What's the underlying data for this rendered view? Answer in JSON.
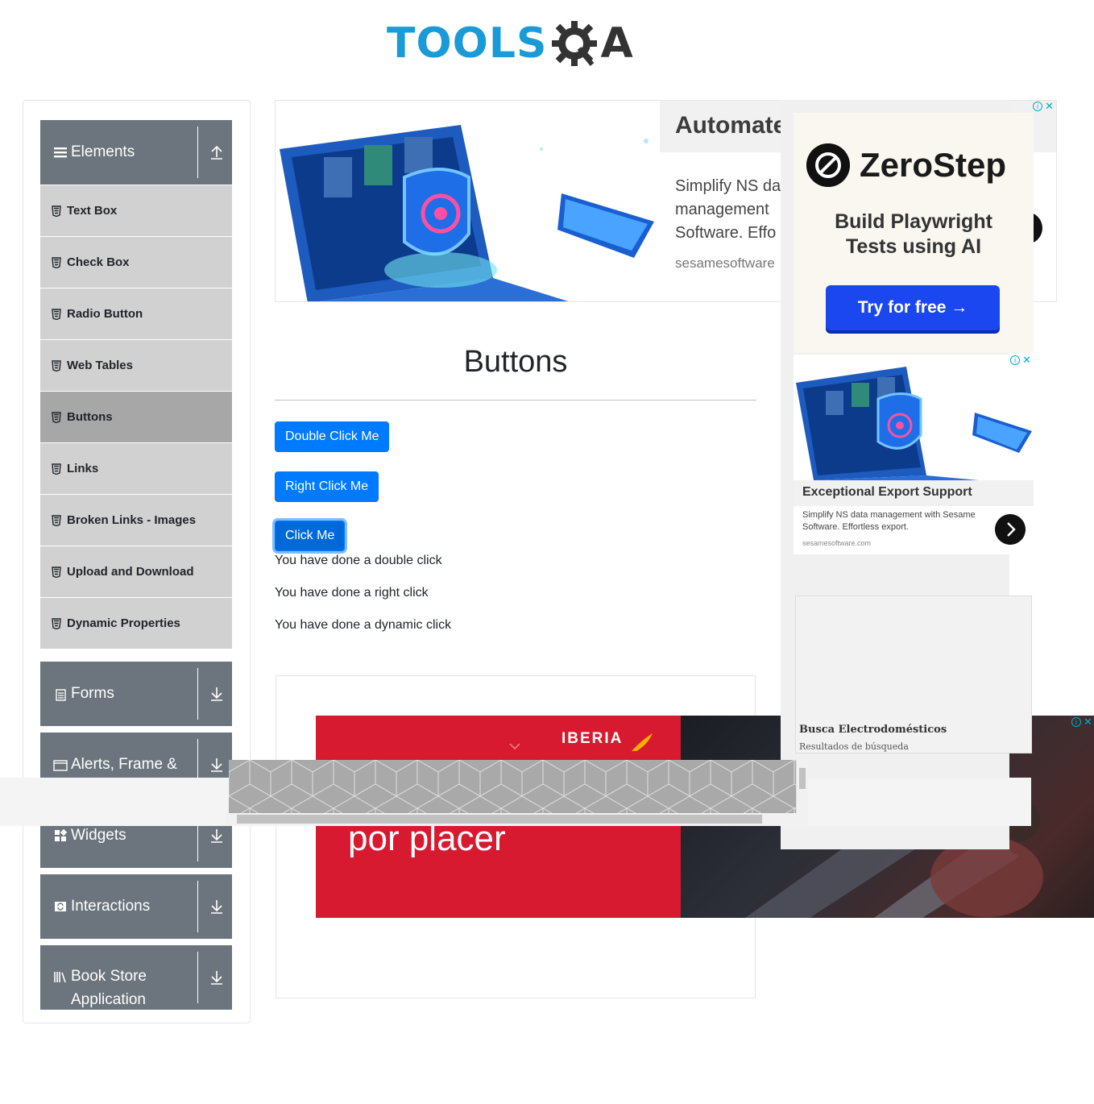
{
  "header": {
    "logo_text": "TOOLS",
    "logo_suffix": "A"
  },
  "sidebar": {
    "groups": [
      {
        "label": "Elements",
        "expanded": true
      },
      {
        "label": "Forms"
      },
      {
        "label": "Alerts, Frame &"
      },
      {
        "label": "Widgets"
      },
      {
        "label": "Interactions"
      },
      {
        "label": "Book Store Application"
      }
    ],
    "items": [
      {
        "label": "Text Box"
      },
      {
        "label": "Check Box"
      },
      {
        "label": "Radio Button"
      },
      {
        "label": "Web Tables"
      },
      {
        "label": "Buttons",
        "active": true
      },
      {
        "label": "Links"
      },
      {
        "label": "Broken Links - Images"
      },
      {
        "label": "Upload and Download"
      },
      {
        "label": "Dynamic Properties"
      }
    ]
  },
  "main": {
    "title": "Buttons",
    "buttons": {
      "double_click": "Double Click Me",
      "right_click": "Right Click Me",
      "click": "Click Me"
    },
    "messages": {
      "double": "You have done a double click",
      "right": "You have done a right click",
      "dynamic": "You have done a dynamic click"
    }
  },
  "ads": {
    "top": {
      "title": "Automate",
      "body_line1": "Simplify NS da",
      "body_line2": "management",
      "body_line3": "Software. Effo",
      "url": "sesamesoftware"
    },
    "zerostep": {
      "brand": "ZeroStep",
      "subtitle_line1": "Build Playwright",
      "subtitle_line2": "Tests using AI",
      "cta": "Try for free →"
    },
    "export": {
      "title": "Exceptional Export Support",
      "body": "Simplify NS data management with Sesame Software. Effortless export.",
      "url": "sesamesoftware.com"
    },
    "busca": {
      "title": "Busca Electrodomésticos",
      "subtitle": "Resultados de búsqueda"
    },
    "iberia": {
      "brand": "IBERIA",
      "text": "por placer"
    }
  },
  "colors": {
    "primary": "#007bff",
    "sidebar_group": "#6c757d",
    "sidebar_item": "#d1d1d1",
    "sidebar_active": "#a7a7a7",
    "logo_blue": "#1a9bd7",
    "iberia_red": "#d71a2f",
    "zerostep_cta": "#1a47f0"
  }
}
